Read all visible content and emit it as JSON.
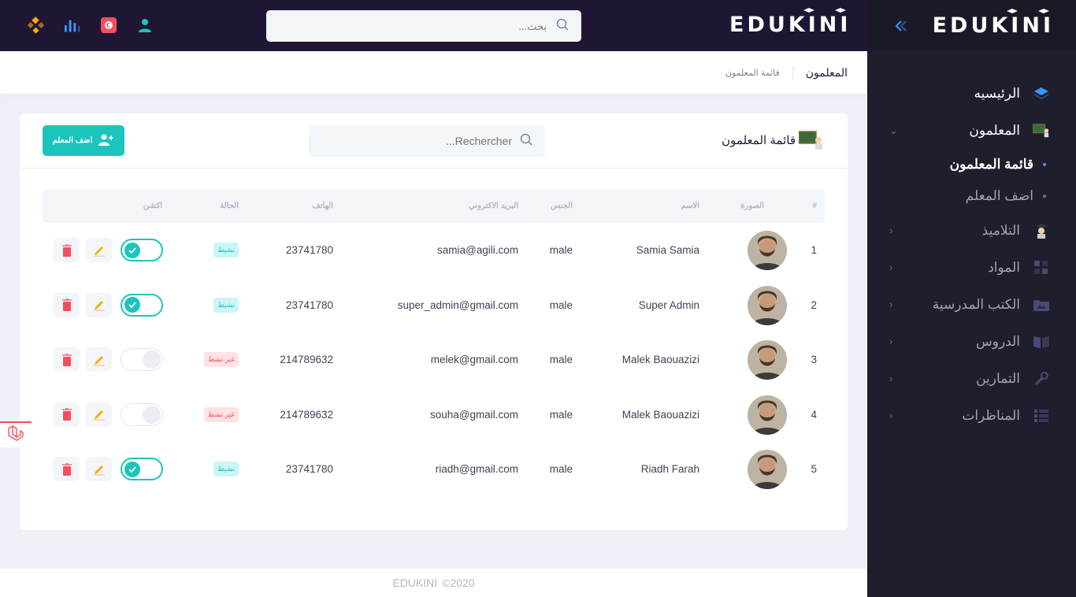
{
  "brand": {
    "logo_text": "EDUKINI"
  },
  "topbar": {
    "search_placeholder": "بحث...",
    "icons": [
      "user-icon",
      "flag-tunisia-icon",
      "stats-icon",
      "apps-icon"
    ]
  },
  "sidebar": {
    "items": [
      {
        "label": "الرئيسيه",
        "icon": "home-layers-icon"
      },
      {
        "label": "المعلمون",
        "icon": "teacher-icon",
        "expanded": true,
        "sub": [
          {
            "label": "قائمة المعلمون",
            "active": true
          },
          {
            "label": "اضف المعلم"
          }
        ]
      },
      {
        "label": "التلاميذ",
        "icon": "student-icon"
      },
      {
        "label": "المواد",
        "icon": "grid-icon"
      },
      {
        "label": "الكتب المدرسية",
        "icon": "folder-image-icon"
      },
      {
        "label": "الدروس",
        "icon": "book-icon"
      },
      {
        "label": "التمارين",
        "icon": "tools-icon"
      },
      {
        "label": "المناظرات",
        "icon": "list-icon"
      }
    ]
  },
  "subheader": {
    "title": "المعلمون",
    "breadcrumb": "قائمة المعلمون"
  },
  "card": {
    "title": "قائمة المعلمون",
    "search_placeholder": "Rechercher...",
    "add_button": "اضف المعلم"
  },
  "table": {
    "headers": {
      "num": "#",
      "photo": "الصورة",
      "name": "الاسم",
      "gender": "الجنس",
      "email": "البريد الاكتروني",
      "phone": "الهاتف",
      "status": "الحالة",
      "action": "اكشن"
    },
    "rows": [
      {
        "num": "1",
        "name": "Samia Samia",
        "gender": "male",
        "email": "samia@agili.com",
        "phone": "23741780",
        "status": "نشيط",
        "active": true
      },
      {
        "num": "2",
        "name": "Super Admin",
        "gender": "male",
        "email": "super_admin@gmail.com",
        "phone": "23741780",
        "status": "نشيط",
        "active": true
      },
      {
        "num": "3",
        "name": "Malek Baouazizi",
        "gender": "male",
        "email": "melek@gmail.com",
        "phone": "214789632",
        "status": "غير نشط",
        "active": false
      },
      {
        "num": "4",
        "name": "Malek Baouazizi",
        "gender": "male",
        "email": "souha@gmail.com",
        "phone": "214789632",
        "status": "غير نشط",
        "active": false
      },
      {
        "num": "5",
        "name": "Riadh Farah",
        "gender": "male",
        "email": "riadh@gmail.com",
        "phone": "23741780",
        "status": "نشيط",
        "active": true
      }
    ]
  },
  "footer": {
    "brand": "EDUKINI",
    "year": "©2020"
  },
  "colors": {
    "accent": "#1bc5bd",
    "danger": "#f64e60",
    "warning": "#ffa800",
    "primary": "#3699ff",
    "sidebar": "#1e1e2d",
    "topbar": "#1f1634"
  }
}
